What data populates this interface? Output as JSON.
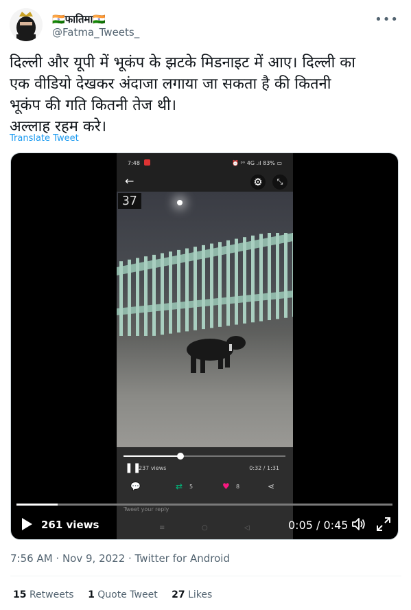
{
  "author": {
    "display_name": "🇮🇳फातिमा🇮🇳",
    "handle": "@Fatma_Tweets_"
  },
  "tweet": {
    "text": "दिल्ली और यूपी में भूकंप के झटके  मिडनाइट  में आए। दिल्ली का\nएक वीडियो देखकर अंदाजा लगाया जा सकता है की कितनी\nभूकंप की गति कितनी तेज थी।\nअल्लाह रहम करे।",
    "translate_label": "Translate Tweet"
  },
  "media": {
    "views_label": "261 views",
    "time_label": "0:05 / 0:45",
    "progress": 0.11,
    "phone": {
      "status_time": "7:48",
      "status_right": "⏰ ᵖᵒ 4G .ıl 83% ▭",
      "counter": "37",
      "views": "237 views",
      "time": "0:32 / 1:31",
      "progress": 0.35,
      "retweets": "5",
      "likes": "8",
      "reply_placeholder": "Tweet your reply"
    }
  },
  "meta": {
    "timestamp": "7:56 AM · Nov 9, 2022 · Twitter for Android"
  },
  "stats": {
    "retweets_count": "15",
    "retweets_label": "Retweets",
    "quotes_count": "1",
    "quotes_label": "Quote Tweet",
    "likes_count": "27",
    "likes_label": "Likes"
  },
  "colors": {
    "link": "#1d9bf0",
    "secondary_text": "#536471",
    "like_pink": "#f91880",
    "retweet_green": "#00ba7c"
  }
}
